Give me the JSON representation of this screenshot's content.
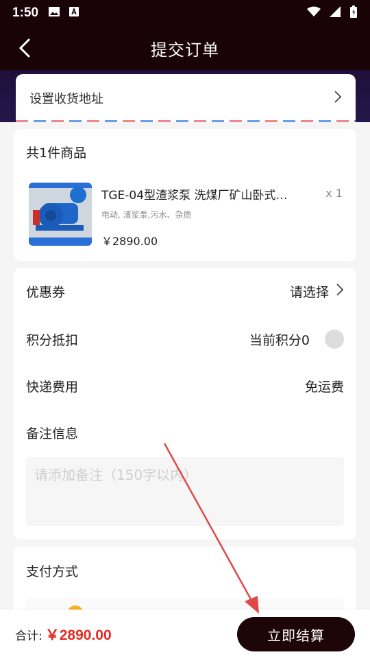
{
  "status_bar": {
    "time": "1:50"
  },
  "header": {
    "title": "提交订单"
  },
  "address": {
    "label": "设置收货地址"
  },
  "products": {
    "title": "共1件商品",
    "items": [
      {
        "name": "TGE-04型渣浆泵 洗煤厂矿山卧式…",
        "tags": "电动, 渣浆泵,污水、杂质",
        "price": "￥2890.00",
        "qty": "x 1"
      }
    ]
  },
  "options": {
    "coupon": {
      "label": "优惠券",
      "value": "请选择"
    },
    "points": {
      "label": "积分抵扣",
      "value": "当前积分0"
    },
    "shipping": {
      "label": "快递费用",
      "value": "免运费"
    },
    "remark": {
      "label": "备注信息",
      "placeholder": "请添加备注（150字以内）"
    }
  },
  "payment": {
    "title": "支付方式"
  },
  "footer": {
    "total_label": "合计:",
    "total_amount": "￥2890.00",
    "submit_label": "立即结算"
  },
  "colors": {
    "header_bg": "#190306",
    "price_red": "#e42a23",
    "button_bg": "#1e0608",
    "annotation_red": "#e04848"
  }
}
